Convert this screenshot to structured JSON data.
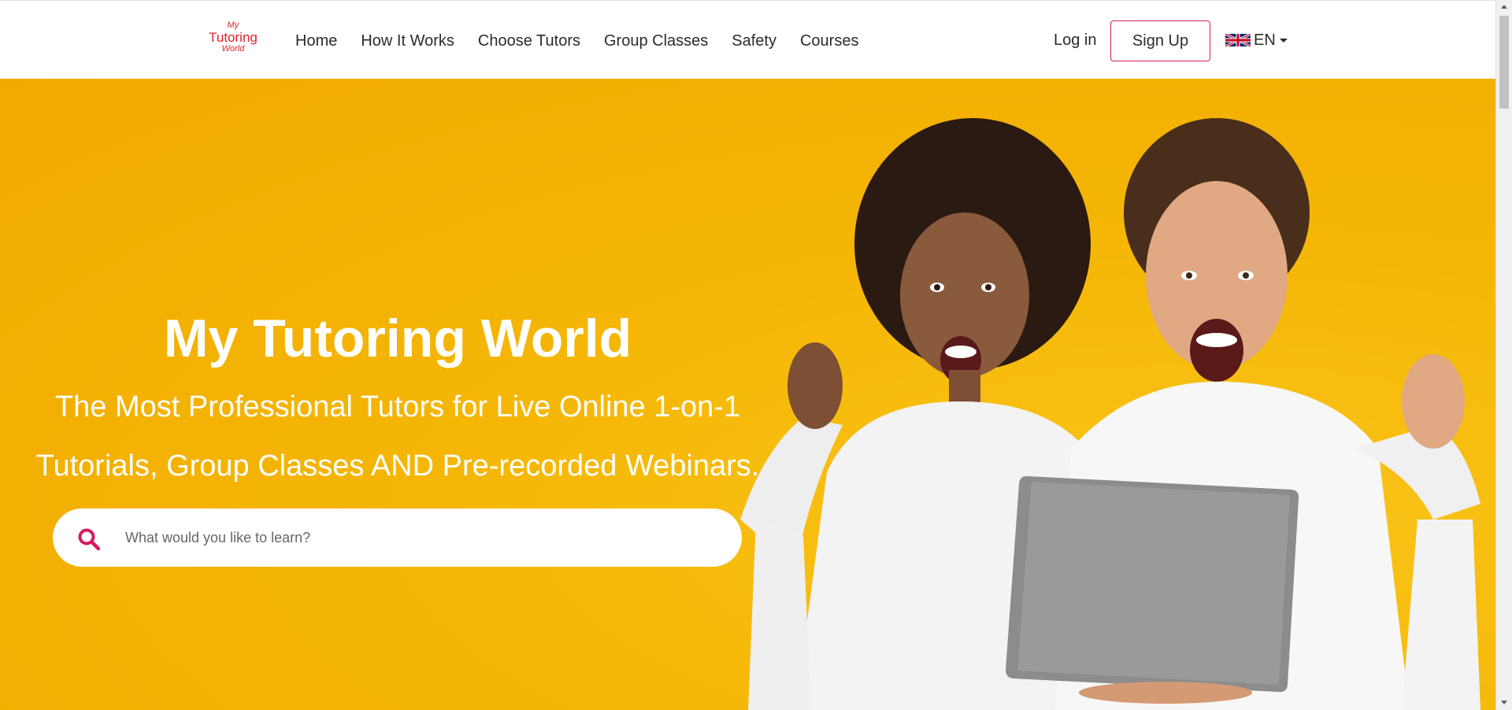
{
  "header": {
    "logo": {
      "line1": "My",
      "line2": "Tutoring",
      "line3": "World"
    },
    "nav": [
      {
        "label": "Home"
      },
      {
        "label": "How It Works"
      },
      {
        "label": "Choose Tutors"
      },
      {
        "label": "Group Classes"
      },
      {
        "label": "Safety"
      },
      {
        "label": "Courses"
      }
    ],
    "login_label": "Log in",
    "signup_label": "Sign Up",
    "language": {
      "code": "EN",
      "flag_icon": "uk-flag-icon"
    }
  },
  "hero": {
    "title": "My Tutoring World",
    "subtitle_line1": "The Most Professional Tutors for Live Online 1-on-1",
    "subtitle_line2": "Tutorials, Group Classes AND Pre-recorded Webinars.",
    "search": {
      "placeholder": "What would you like to learn?",
      "value": "",
      "icon": "search-icon"
    },
    "image": "two-excited-people-with-laptop"
  },
  "colors": {
    "brand_red": "#e0202a",
    "accent_pink": "#d81b60",
    "hero_yellow": "#f5b606"
  }
}
